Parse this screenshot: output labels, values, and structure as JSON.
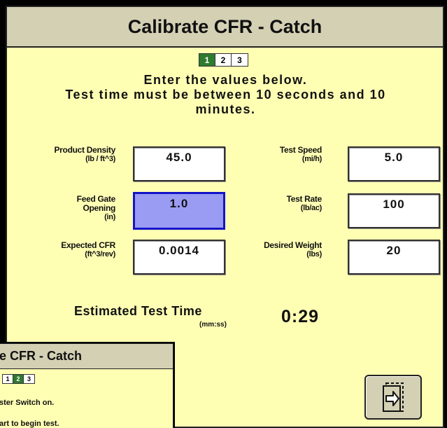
{
  "main_dialog": {
    "title": "Calibrate CFR - Catch",
    "steps": [
      "1",
      "2",
      "3"
    ],
    "active_step": 1,
    "instruction_line1": "Enter the values below.",
    "instruction_line2": "Test time must be between 10 seconds and 10",
    "instruction_line3": "minutes.",
    "fields": {
      "product_density": {
        "label": "Product Density",
        "unit": "(lb / ft^3)",
        "value": "45.0"
      },
      "feed_gate_opening": {
        "label1": "Feed Gate",
        "label2": "Opening",
        "unit": "(in)",
        "value": "1.0"
      },
      "expected_cfr": {
        "label": "Expected CFR",
        "unit": "(ft^3/rev)",
        "value": "0.0014"
      },
      "test_speed": {
        "label": "Test Speed",
        "unit": "(mi/h)",
        "value": "5.0"
      },
      "test_rate": {
        "label": "Test Rate",
        "unit": "(lb/ac)",
        "value": "100"
      },
      "desired_weight": {
        "label": "Desired Weight",
        "unit": "(lbs)",
        "value": "20"
      }
    },
    "estimated_time": {
      "label": "Estimated Test Time",
      "unit": "(mm:ss)",
      "value": "0:29"
    },
    "next_button_icon": "next-page-arrow-icon"
  },
  "sub_dialog": {
    "title": "e CFR - Catch",
    "steps": [
      "1",
      "2",
      "3"
    ],
    "active_step": 2,
    "line1": "ster Switch on.",
    "line2": "art to begin test."
  },
  "colors": {
    "panel_background": "#ffffb4",
    "titlebar": "#d4d0b4",
    "active_step": "#2e7a2e",
    "selected_field": "#9a9cf4",
    "selected_border": "#1414c8"
  }
}
